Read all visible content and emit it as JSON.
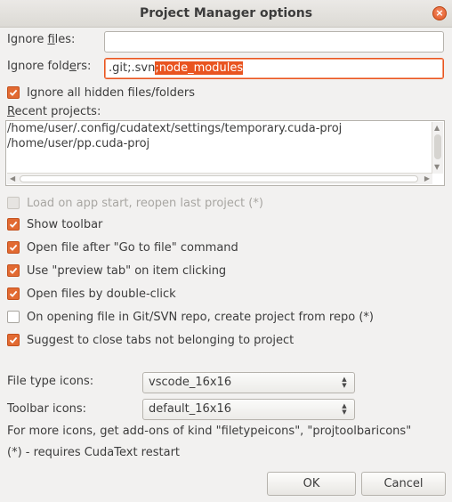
{
  "window": {
    "title": "Project Manager options",
    "close_symbol": "×"
  },
  "ignore_files": {
    "label_pre": "Ignore ",
    "label_accel": "f",
    "label_post": "iles:",
    "value": ""
  },
  "ignore_folders": {
    "label_pre": "Ignore fold",
    "label_accel": "e",
    "label_post": "rs:",
    "value_plain": ".git;.svn",
    "value_selected": ";node_modules"
  },
  "ignore_hidden": {
    "label": "Ignore all hidden files/folders",
    "checked": true
  },
  "recent_projects": {
    "label_accel": "R",
    "label_post": "ecent projects:",
    "items": [
      "/home/user/.config/cudatext/settings/temporary.cuda-proj",
      "/home/user/pp.cuda-proj"
    ]
  },
  "options": [
    {
      "label": "Load on app start, reopen last project (*)",
      "state": "disabled"
    },
    {
      "label": "Show toolbar",
      "state": "checked"
    },
    {
      "label": "Open file after \"Go to file\" command",
      "state": "checked"
    },
    {
      "label": "Use \"preview tab\" on item clicking",
      "state": "checked"
    },
    {
      "label": "Open files by double-click",
      "state": "checked"
    },
    {
      "label": "On opening file in Git/SVN repo, create project from repo (*)",
      "state": "unchecked"
    },
    {
      "label": "Suggest to close tabs not belonging to project",
      "state": "checked"
    }
  ],
  "file_type_icons": {
    "label": "File type icons:",
    "value": "vscode_16x16"
  },
  "toolbar_icons": {
    "label": "Toolbar icons:",
    "value": "default_16x16"
  },
  "notes": {
    "more_icons": "For more icons, get add-ons of kind \"filetypeicons\", \"projtoolbaricons\"",
    "restart": "(*) - requires CudaText restart"
  },
  "buttons": {
    "ok": "OK",
    "cancel": "Cancel"
  },
  "colors": {
    "accent": "#e95420",
    "checkbox": "#e26a32"
  }
}
